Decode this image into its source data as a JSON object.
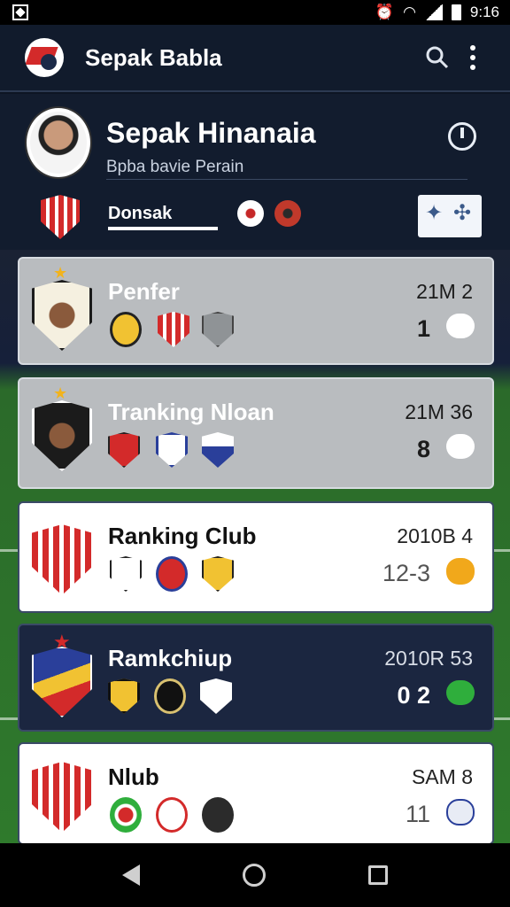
{
  "status_bar": {
    "time": "9:16"
  },
  "app_bar": {
    "title": "Sepak Babla",
    "icons": [
      "search-icon",
      "more-vert-icon"
    ]
  },
  "profile": {
    "name": "Sepak Hinanaia",
    "subtitle": "Bpba bavie Perain",
    "tag_label": "Donsak",
    "icons": [
      "power-icon",
      "club-crest-icon",
      "soccer-ball-icon",
      "badge-icon"
    ]
  },
  "cards": [
    {
      "title": "Penfer",
      "meta": "21M 2",
      "number": "1",
      "style": "gray"
    },
    {
      "title": "Tranking Nloan",
      "meta": "21M 36",
      "number": "8",
      "style": "gray"
    },
    {
      "title": "Ranking Club",
      "meta": "2010B 4",
      "number": "12-3",
      "style": "white"
    },
    {
      "title": "Ramkchiup",
      "meta": "2010R 53",
      "number": "0 2",
      "style": "dark"
    },
    {
      "title": "Nlub",
      "meta": "SAM 8",
      "number": "11",
      "style": "white"
    }
  ],
  "colors": {
    "accent_red": "#d32a2a",
    "accent_gold": "#f2b31c",
    "dark_bg": "#121c2e",
    "card_gray": "#b9bcbf"
  }
}
